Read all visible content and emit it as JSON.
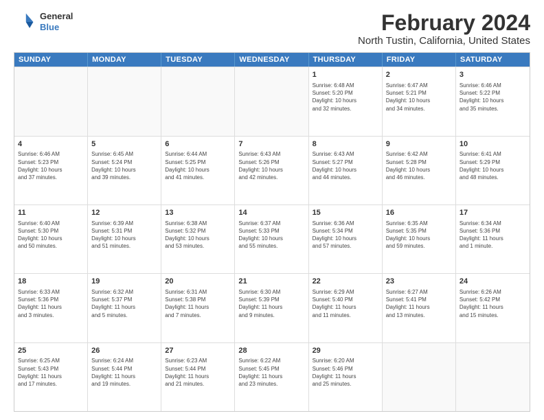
{
  "header": {
    "logo_line1": "General",
    "logo_line2": "Blue",
    "main_title": "February 2024",
    "subtitle": "North Tustin, California, United States"
  },
  "calendar": {
    "weekdays": [
      "Sunday",
      "Monday",
      "Tuesday",
      "Wednesday",
      "Thursday",
      "Friday",
      "Saturday"
    ],
    "rows": [
      [
        {
          "day": "",
          "info": "",
          "empty": true
        },
        {
          "day": "",
          "info": "",
          "empty": true
        },
        {
          "day": "",
          "info": "",
          "empty": true
        },
        {
          "day": "",
          "info": "",
          "empty": true
        },
        {
          "day": "1",
          "info": "Sunrise: 6:48 AM\nSunset: 5:20 PM\nDaylight: 10 hours\nand 32 minutes."
        },
        {
          "day": "2",
          "info": "Sunrise: 6:47 AM\nSunset: 5:21 PM\nDaylight: 10 hours\nand 34 minutes."
        },
        {
          "day": "3",
          "info": "Sunrise: 6:46 AM\nSunset: 5:22 PM\nDaylight: 10 hours\nand 35 minutes."
        }
      ],
      [
        {
          "day": "4",
          "info": "Sunrise: 6:46 AM\nSunset: 5:23 PM\nDaylight: 10 hours\nand 37 minutes."
        },
        {
          "day": "5",
          "info": "Sunrise: 6:45 AM\nSunset: 5:24 PM\nDaylight: 10 hours\nand 39 minutes."
        },
        {
          "day": "6",
          "info": "Sunrise: 6:44 AM\nSunset: 5:25 PM\nDaylight: 10 hours\nand 41 minutes."
        },
        {
          "day": "7",
          "info": "Sunrise: 6:43 AM\nSunset: 5:26 PM\nDaylight: 10 hours\nand 42 minutes."
        },
        {
          "day": "8",
          "info": "Sunrise: 6:43 AM\nSunset: 5:27 PM\nDaylight: 10 hours\nand 44 minutes."
        },
        {
          "day": "9",
          "info": "Sunrise: 6:42 AM\nSunset: 5:28 PM\nDaylight: 10 hours\nand 46 minutes."
        },
        {
          "day": "10",
          "info": "Sunrise: 6:41 AM\nSunset: 5:29 PM\nDaylight: 10 hours\nand 48 minutes."
        }
      ],
      [
        {
          "day": "11",
          "info": "Sunrise: 6:40 AM\nSunset: 5:30 PM\nDaylight: 10 hours\nand 50 minutes."
        },
        {
          "day": "12",
          "info": "Sunrise: 6:39 AM\nSunset: 5:31 PM\nDaylight: 10 hours\nand 51 minutes."
        },
        {
          "day": "13",
          "info": "Sunrise: 6:38 AM\nSunset: 5:32 PM\nDaylight: 10 hours\nand 53 minutes."
        },
        {
          "day": "14",
          "info": "Sunrise: 6:37 AM\nSunset: 5:33 PM\nDaylight: 10 hours\nand 55 minutes."
        },
        {
          "day": "15",
          "info": "Sunrise: 6:36 AM\nSunset: 5:34 PM\nDaylight: 10 hours\nand 57 minutes."
        },
        {
          "day": "16",
          "info": "Sunrise: 6:35 AM\nSunset: 5:35 PM\nDaylight: 10 hours\nand 59 minutes."
        },
        {
          "day": "17",
          "info": "Sunrise: 6:34 AM\nSunset: 5:36 PM\nDaylight: 11 hours\nand 1 minute."
        }
      ],
      [
        {
          "day": "18",
          "info": "Sunrise: 6:33 AM\nSunset: 5:36 PM\nDaylight: 11 hours\nand 3 minutes."
        },
        {
          "day": "19",
          "info": "Sunrise: 6:32 AM\nSunset: 5:37 PM\nDaylight: 11 hours\nand 5 minutes."
        },
        {
          "day": "20",
          "info": "Sunrise: 6:31 AM\nSunset: 5:38 PM\nDaylight: 11 hours\nand 7 minutes."
        },
        {
          "day": "21",
          "info": "Sunrise: 6:30 AM\nSunset: 5:39 PM\nDaylight: 11 hours\nand 9 minutes."
        },
        {
          "day": "22",
          "info": "Sunrise: 6:29 AM\nSunset: 5:40 PM\nDaylight: 11 hours\nand 11 minutes."
        },
        {
          "day": "23",
          "info": "Sunrise: 6:27 AM\nSunset: 5:41 PM\nDaylight: 11 hours\nand 13 minutes."
        },
        {
          "day": "24",
          "info": "Sunrise: 6:26 AM\nSunset: 5:42 PM\nDaylight: 11 hours\nand 15 minutes."
        }
      ],
      [
        {
          "day": "25",
          "info": "Sunrise: 6:25 AM\nSunset: 5:43 PM\nDaylight: 11 hours\nand 17 minutes."
        },
        {
          "day": "26",
          "info": "Sunrise: 6:24 AM\nSunset: 5:44 PM\nDaylight: 11 hours\nand 19 minutes."
        },
        {
          "day": "27",
          "info": "Sunrise: 6:23 AM\nSunset: 5:44 PM\nDaylight: 11 hours\nand 21 minutes."
        },
        {
          "day": "28",
          "info": "Sunrise: 6:22 AM\nSunset: 5:45 PM\nDaylight: 11 hours\nand 23 minutes."
        },
        {
          "day": "29",
          "info": "Sunrise: 6:20 AM\nSunset: 5:46 PM\nDaylight: 11 hours\nand 25 minutes."
        },
        {
          "day": "",
          "info": "",
          "empty": true
        },
        {
          "day": "",
          "info": "",
          "empty": true
        }
      ]
    ]
  }
}
